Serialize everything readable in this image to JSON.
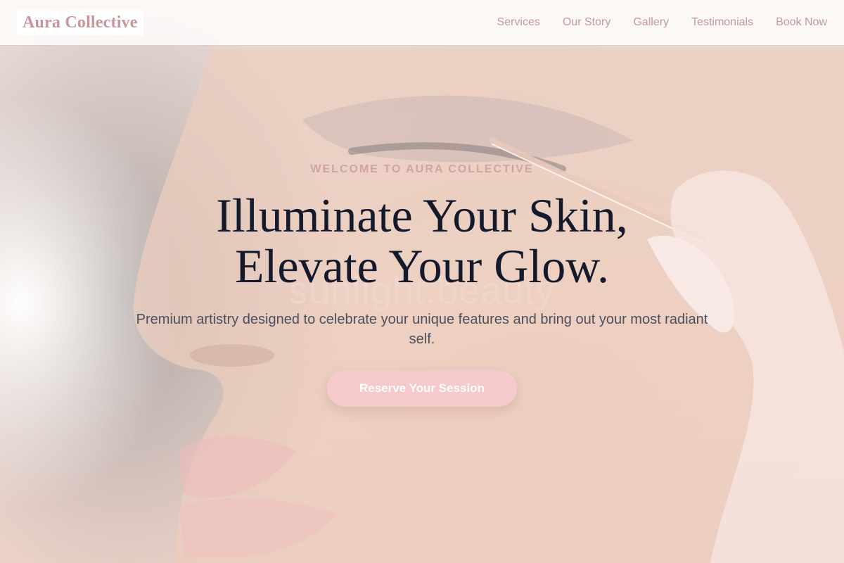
{
  "brand": {
    "name": "Aura Collective"
  },
  "nav": {
    "items": [
      {
        "label": "Services"
      },
      {
        "label": "Our Story"
      },
      {
        "label": "Gallery"
      },
      {
        "label": "Testimonials"
      },
      {
        "label": "Book Now"
      }
    ]
  },
  "hero": {
    "eyebrow": "WELCOME TO AURA COLLECTIVE",
    "headline_line1": "Illuminate Your Skin,",
    "headline_line2": "Elevate Your Glow.",
    "subtext": "Premium artistry designed to celebrate your unique features and bring out your most radiant self.",
    "cta_label": "Reserve Your Session",
    "image_watermark": "sunlight.beauty"
  },
  "colors": {
    "accent": "#f6c9cb",
    "brand_text": "#c9959a",
    "headline": "#141a2b"
  }
}
